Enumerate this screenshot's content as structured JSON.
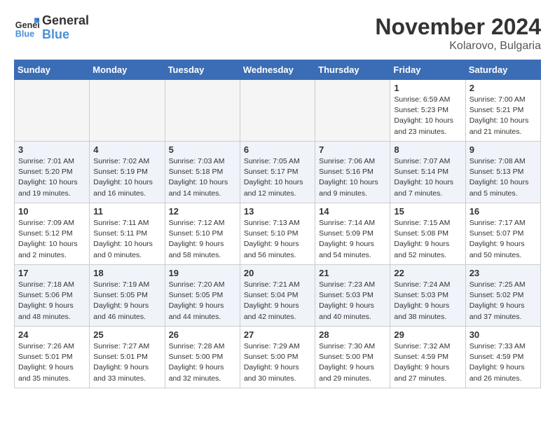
{
  "logo": {
    "general": "General",
    "blue": "Blue"
  },
  "title": "November 2024",
  "location": "Kolarovo, Bulgaria",
  "days_of_week": [
    "Sunday",
    "Monday",
    "Tuesday",
    "Wednesday",
    "Thursday",
    "Friday",
    "Saturday"
  ],
  "weeks": [
    [
      {
        "day": "",
        "info": "",
        "empty": true
      },
      {
        "day": "",
        "info": "",
        "empty": true
      },
      {
        "day": "",
        "info": "",
        "empty": true
      },
      {
        "day": "",
        "info": "",
        "empty": true
      },
      {
        "day": "",
        "info": "",
        "empty": true
      },
      {
        "day": "1",
        "info": "Sunrise: 6:59 AM\nSunset: 5:23 PM\nDaylight: 10 hours\nand 23 minutes.",
        "empty": false
      },
      {
        "day": "2",
        "info": "Sunrise: 7:00 AM\nSunset: 5:21 PM\nDaylight: 10 hours\nand 21 minutes.",
        "empty": false
      }
    ],
    [
      {
        "day": "3",
        "info": "Sunrise: 7:01 AM\nSunset: 5:20 PM\nDaylight: 10 hours\nand 19 minutes.",
        "empty": false
      },
      {
        "day": "4",
        "info": "Sunrise: 7:02 AM\nSunset: 5:19 PM\nDaylight: 10 hours\nand 16 minutes.",
        "empty": false
      },
      {
        "day": "5",
        "info": "Sunrise: 7:03 AM\nSunset: 5:18 PM\nDaylight: 10 hours\nand 14 minutes.",
        "empty": false
      },
      {
        "day": "6",
        "info": "Sunrise: 7:05 AM\nSunset: 5:17 PM\nDaylight: 10 hours\nand 12 minutes.",
        "empty": false
      },
      {
        "day": "7",
        "info": "Sunrise: 7:06 AM\nSunset: 5:16 PM\nDaylight: 10 hours\nand 9 minutes.",
        "empty": false
      },
      {
        "day": "8",
        "info": "Sunrise: 7:07 AM\nSunset: 5:14 PM\nDaylight: 10 hours\nand 7 minutes.",
        "empty": false
      },
      {
        "day": "9",
        "info": "Sunrise: 7:08 AM\nSunset: 5:13 PM\nDaylight: 10 hours\nand 5 minutes.",
        "empty": false
      }
    ],
    [
      {
        "day": "10",
        "info": "Sunrise: 7:09 AM\nSunset: 5:12 PM\nDaylight: 10 hours\nand 2 minutes.",
        "empty": false
      },
      {
        "day": "11",
        "info": "Sunrise: 7:11 AM\nSunset: 5:11 PM\nDaylight: 10 hours\nand 0 minutes.",
        "empty": false
      },
      {
        "day": "12",
        "info": "Sunrise: 7:12 AM\nSunset: 5:10 PM\nDaylight: 9 hours\nand 58 minutes.",
        "empty": false
      },
      {
        "day": "13",
        "info": "Sunrise: 7:13 AM\nSunset: 5:10 PM\nDaylight: 9 hours\nand 56 minutes.",
        "empty": false
      },
      {
        "day": "14",
        "info": "Sunrise: 7:14 AM\nSunset: 5:09 PM\nDaylight: 9 hours\nand 54 minutes.",
        "empty": false
      },
      {
        "day": "15",
        "info": "Sunrise: 7:15 AM\nSunset: 5:08 PM\nDaylight: 9 hours\nand 52 minutes.",
        "empty": false
      },
      {
        "day": "16",
        "info": "Sunrise: 7:17 AM\nSunset: 5:07 PM\nDaylight: 9 hours\nand 50 minutes.",
        "empty": false
      }
    ],
    [
      {
        "day": "17",
        "info": "Sunrise: 7:18 AM\nSunset: 5:06 PM\nDaylight: 9 hours\nand 48 minutes.",
        "empty": false
      },
      {
        "day": "18",
        "info": "Sunrise: 7:19 AM\nSunset: 5:05 PM\nDaylight: 9 hours\nand 46 minutes.",
        "empty": false
      },
      {
        "day": "19",
        "info": "Sunrise: 7:20 AM\nSunset: 5:05 PM\nDaylight: 9 hours\nand 44 minutes.",
        "empty": false
      },
      {
        "day": "20",
        "info": "Sunrise: 7:21 AM\nSunset: 5:04 PM\nDaylight: 9 hours\nand 42 minutes.",
        "empty": false
      },
      {
        "day": "21",
        "info": "Sunrise: 7:23 AM\nSunset: 5:03 PM\nDaylight: 9 hours\nand 40 minutes.",
        "empty": false
      },
      {
        "day": "22",
        "info": "Sunrise: 7:24 AM\nSunset: 5:03 PM\nDaylight: 9 hours\nand 38 minutes.",
        "empty": false
      },
      {
        "day": "23",
        "info": "Sunrise: 7:25 AM\nSunset: 5:02 PM\nDaylight: 9 hours\nand 37 minutes.",
        "empty": false
      }
    ],
    [
      {
        "day": "24",
        "info": "Sunrise: 7:26 AM\nSunset: 5:01 PM\nDaylight: 9 hours\nand 35 minutes.",
        "empty": false
      },
      {
        "day": "25",
        "info": "Sunrise: 7:27 AM\nSunset: 5:01 PM\nDaylight: 9 hours\nand 33 minutes.",
        "empty": false
      },
      {
        "day": "26",
        "info": "Sunrise: 7:28 AM\nSunset: 5:00 PM\nDaylight: 9 hours\nand 32 minutes.",
        "empty": false
      },
      {
        "day": "27",
        "info": "Sunrise: 7:29 AM\nSunset: 5:00 PM\nDaylight: 9 hours\nand 30 minutes.",
        "empty": false
      },
      {
        "day": "28",
        "info": "Sunrise: 7:30 AM\nSunset: 5:00 PM\nDaylight: 9 hours\nand 29 minutes.",
        "empty": false
      },
      {
        "day": "29",
        "info": "Sunrise: 7:32 AM\nSunset: 4:59 PM\nDaylight: 9 hours\nand 27 minutes.",
        "empty": false
      },
      {
        "day": "30",
        "info": "Sunrise: 7:33 AM\nSunset: 4:59 PM\nDaylight: 9 hours\nand 26 minutes.",
        "empty": false
      }
    ]
  ]
}
